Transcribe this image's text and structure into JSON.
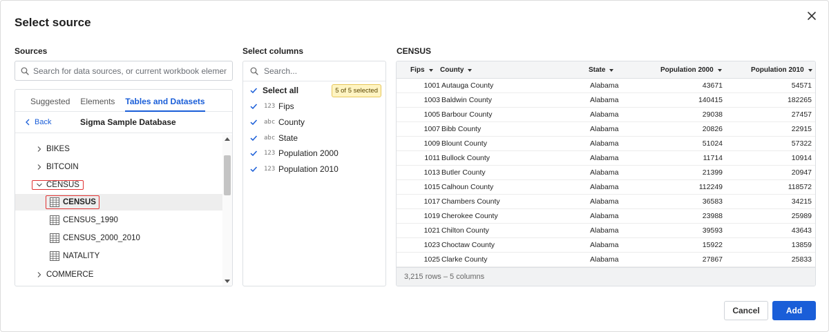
{
  "dialog": {
    "title": "Select source"
  },
  "sources": {
    "label": "Sources",
    "search_placeholder": "Search for data sources, or current workbook elements",
    "tabs": [
      {
        "label": "Suggested",
        "active": false
      },
      {
        "label": "Elements",
        "active": false
      },
      {
        "label": "Tables and Datasets",
        "active": true
      }
    ],
    "back_label": "Back",
    "database_title": "Sigma Sample Database",
    "tree": [
      {
        "label": "BIKES",
        "kind": "folder",
        "expanded": false
      },
      {
        "label": "BITCOIN",
        "kind": "folder",
        "expanded": false
      },
      {
        "label": "CENSUS",
        "kind": "folder",
        "expanded": true
      },
      {
        "label": "CENSUS",
        "kind": "table",
        "selected": true
      },
      {
        "label": "CENSUS_1990",
        "kind": "table",
        "selected": false
      },
      {
        "label": "CENSUS_2000_2010",
        "kind": "table",
        "selected": false
      },
      {
        "label": "NATALITY",
        "kind": "table",
        "selected": false
      },
      {
        "label": "COMMERCE",
        "kind": "folder",
        "expanded": false
      }
    ]
  },
  "columns": {
    "label": "Select columns",
    "search_placeholder": "Search...",
    "select_all_label": "Select all",
    "selected_badge": "5 of 5 selected",
    "items": [
      {
        "type": "123",
        "name": "Fips",
        "checked": true
      },
      {
        "type": "abc",
        "name": "County",
        "checked": true
      },
      {
        "type": "abc",
        "name": "State",
        "checked": true
      },
      {
        "type": "123",
        "name": "Population 2000",
        "checked": true
      },
      {
        "type": "123",
        "name": "Population 2010",
        "checked": true
      }
    ]
  },
  "preview": {
    "title": "CENSUS",
    "headers": [
      "Fips",
      "County",
      "State",
      "Population 2000",
      "Population 2010"
    ],
    "rows": [
      [
        "1001",
        "Autauga County",
        "Alabama",
        "43671",
        "54571"
      ],
      [
        "1003",
        "Baldwin County",
        "Alabama",
        "140415",
        "182265"
      ],
      [
        "1005",
        "Barbour County",
        "Alabama",
        "29038",
        "27457"
      ],
      [
        "1007",
        "Bibb County",
        "Alabama",
        "20826",
        "22915"
      ],
      [
        "1009",
        "Blount County",
        "Alabama",
        "51024",
        "57322"
      ],
      [
        "1011",
        "Bullock County",
        "Alabama",
        "11714",
        "10914"
      ],
      [
        "1013",
        "Butler County",
        "Alabama",
        "21399",
        "20947"
      ],
      [
        "1015",
        "Calhoun County",
        "Alabama",
        "112249",
        "118572"
      ],
      [
        "1017",
        "Chambers County",
        "Alabama",
        "36583",
        "34215"
      ],
      [
        "1019",
        "Cherokee County",
        "Alabama",
        "23988",
        "25989"
      ],
      [
        "1021",
        "Chilton County",
        "Alabama",
        "39593",
        "43643"
      ],
      [
        "1023",
        "Choctaw County",
        "Alabama",
        "15922",
        "13859"
      ],
      [
        "1025",
        "Clarke County",
        "Alabama",
        "27867",
        "25833"
      ]
    ],
    "footer": "3,215 rows – 5 columns"
  },
  "actions": {
    "cancel_label": "Cancel",
    "add_label": "Add"
  },
  "colors": {
    "accent": "#1a5ed8",
    "highlight": "#e03131",
    "badge_bg": "#fff4c2"
  }
}
